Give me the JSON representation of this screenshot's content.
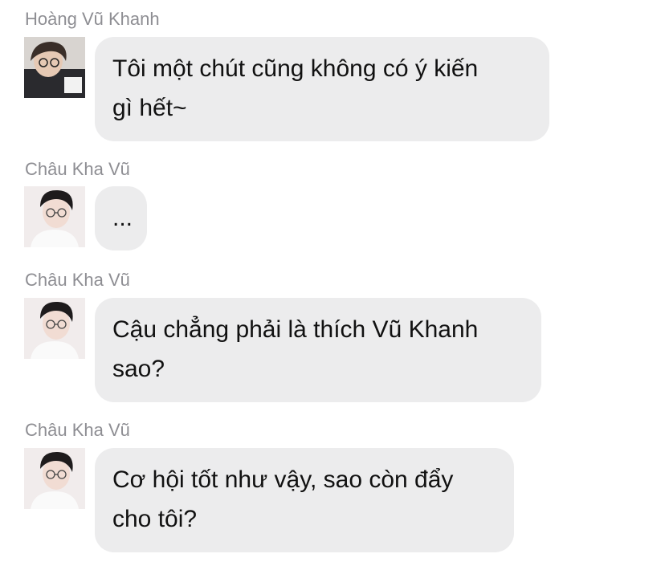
{
  "messages": [
    {
      "sender": "Hoàng Vũ Khanh",
      "avatar_icon": "dark-hair-boy-avatar-icon",
      "lines": [
        "Tôi một chút cũng không có ý kiến",
        "gì hết~"
      ]
    },
    {
      "sender": "Châu Kha Vũ",
      "avatar_icon": "glasses-boy-avatar-icon",
      "lines": [
        "..."
      ]
    },
    {
      "sender": "Châu Kha Vũ",
      "avatar_icon": "glasses-boy-avatar-icon",
      "lines": [
        "Cậu chẳng phải là thích Vũ Khanh",
        "sao?"
      ]
    },
    {
      "sender": "Châu Kha Vũ",
      "avatar_icon": "glasses-boy-avatar-icon",
      "lines": [
        "Cơ hội tốt như vậy, sao còn đẩy",
        "cho tôi?"
      ]
    }
  ],
  "colors": {
    "bubble_bg": "#ececed",
    "sender_text": "#8e8e93",
    "message_text": "#111111"
  }
}
